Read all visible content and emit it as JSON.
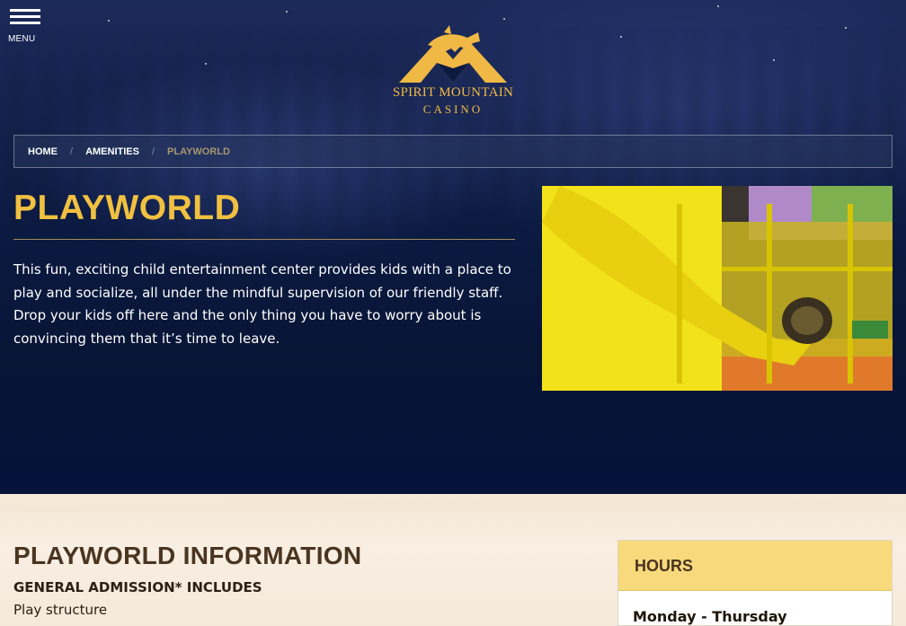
{
  "header": {
    "menu_label": "MENU",
    "logo_name": "SPIRIT MOUNTAIN",
    "logo_sub": "CASINO"
  },
  "breadcrumb": {
    "items": [
      "HOME",
      "AMENITIES"
    ],
    "separator": "/",
    "current": "PLAYWORLD"
  },
  "intro": {
    "title": "PLAYWORLD",
    "text": "This fun, exciting child entertainment center provides kids with a place to play and socialize, all under the mindful supervision of our friendly staff. Drop your kids off here and the only thing you have to worry about is convincing them that it’s time to leave."
  },
  "info": {
    "title": "PLAYWORLD INFORMATION",
    "subtitle": "GENERAL ADMISSION* INCLUDES",
    "items": [
      "Play structure"
    ]
  },
  "hours": {
    "title": "HOURS",
    "day": "Monday - Thursday"
  },
  "colors": {
    "accent": "#f0c040",
    "hero_bg": "#0a1738",
    "lower_bg": "#f5e9da",
    "hours_header": "#f8d97c"
  },
  "icons": {
    "menu": "hamburger-icon",
    "logo": "spirit-mountain-logo-icon"
  }
}
